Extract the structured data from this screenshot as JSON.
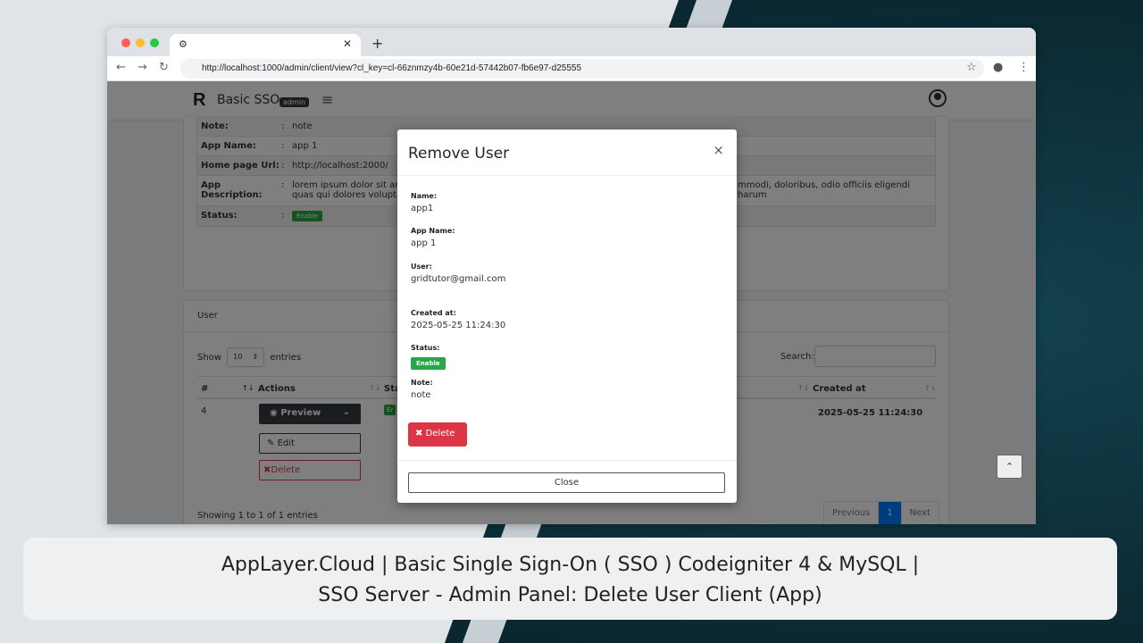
{
  "browser": {
    "tab_icon": "chrome-settings-icon",
    "url": "http://localhost:1000/admin/client/view?cl_key=cl-66znmzy4b-60e21d-57442b07-fb6e97-d25555"
  },
  "navbar": {
    "logo": "R",
    "brand": "Basic SSO",
    "badge": "admin"
  },
  "info_rows": [
    {
      "label": "Note:",
      "value": "note"
    },
    {
      "label": "App Name:",
      "value": "app 1"
    },
    {
      "label": "Home page Url:",
      "value": "http://localhost:2000/"
    },
    {
      "label": "App Description:",
      "value": "lorem ipsum dolor sit am",
      "value_tail": "mmodi, doloribus, odio officiis eligendi harum",
      "value_line2": "quas qui dolores volupta"
    },
    {
      "label": "Status:",
      "status": "Enable"
    }
  ],
  "user_card": {
    "header": "User",
    "show": "Show",
    "entries_value": "10",
    "entries": "entries",
    "search_label": "Search:",
    "columns": {
      "num": "#",
      "actions": "Actions",
      "status": "Sta",
      "created": "Created at"
    },
    "row": {
      "num": "4",
      "status": "Er",
      "created": "2025-05-25 11:24:30"
    },
    "preview_label": "Preview",
    "edit_label": "Edit",
    "delete_label": "Delete",
    "showing": "Showing 1 to 1 of 1 entries",
    "pager": {
      "prev": "Previous",
      "page": "1",
      "next": "Next"
    }
  },
  "modal": {
    "title": "Remove User",
    "close_x": "×",
    "fields": {
      "name_label": "Name:",
      "name": "app1",
      "app_label": "App Name:",
      "app": "app 1",
      "user_label": "User:",
      "user": "gridtutor@gmail.com",
      "created_label": "Created at:",
      "created": "2025-05-25 11:24:30",
      "status_label": "Status:",
      "status": "Enable",
      "note_label": "Note:",
      "note": "note"
    },
    "delete_label": "Delete",
    "close_label": "Close"
  },
  "caption": {
    "line1": "AppLayer.Cloud | Basic Single Sign-On ( SSO ) Codeigniter 4 & MySQL |",
    "line2": "SSO Server - Admin Panel: Delete User Client (App)"
  },
  "colors": {
    "danger": "#dc3545",
    "success": "#28a745",
    "primary": "#007bff",
    "dark": "#343a40"
  }
}
